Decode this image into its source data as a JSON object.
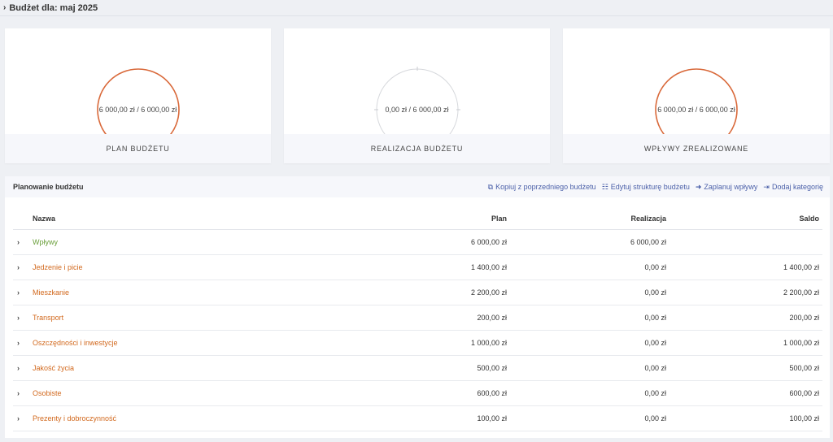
{
  "header": {
    "title": "Budżet dla: maj 2025",
    "toggle_icon": "chevron-right-icon"
  },
  "colors": {
    "accent_orange": "#d9693a",
    "income_green": "#6a9f3a",
    "link_blue": "#4a5fa8",
    "ring_empty": "#d6d8dc"
  },
  "cards": [
    {
      "value": "6 000,00 zł / 6 000,00 zł",
      "label": "PLAN BUDŻETU",
      "progress": 1.0
    },
    {
      "value": "0,00 zł / 6 000,00 zł",
      "label": "REALIZACJA BUDŻETU",
      "progress": 0.0
    },
    {
      "value": "6 000,00 zł / 6 000,00 zł",
      "label": "WPŁYWY ZREALIZOWANE",
      "progress": 1.0
    }
  ],
  "planning": {
    "title": "Planowanie budżetu",
    "actions": [
      {
        "label": "Kopiuj z poprzedniego budżetu",
        "icon": "copy-icon"
      },
      {
        "label": "Edytuj strukturę budżetu",
        "icon": "sitemap-icon"
      },
      {
        "label": "Zaplanuj wpływy",
        "icon": "sign-in-icon"
      },
      {
        "label": "Dodaj kategorię",
        "icon": "sign-out-icon"
      }
    ],
    "columns": {
      "name": "Nazwa",
      "plan": "Plan",
      "realized": "Realizacja",
      "balance": "Saldo"
    },
    "rows": [
      {
        "name": "Wpływy",
        "plan": "6 000,00 zł",
        "realized": "6 000,00 zł",
        "balance": "",
        "type": "income"
      },
      {
        "name": "Jedzenie i picie",
        "plan": "1 400,00 zł",
        "realized": "0,00 zł",
        "balance": "1 400,00 zł",
        "type": "expense"
      },
      {
        "name": "Mieszkanie",
        "plan": "2 200,00 zł",
        "realized": "0,00 zł",
        "balance": "2 200,00 zł",
        "type": "expense"
      },
      {
        "name": "Transport",
        "plan": "200,00 zł",
        "realized": "0,00 zł",
        "balance": "200,00 zł",
        "type": "expense"
      },
      {
        "name": "Oszczędności i inwestycje",
        "plan": "1 000,00 zł",
        "realized": "0,00 zł",
        "balance": "1 000,00 zł",
        "type": "expense"
      },
      {
        "name": "Jakość życia",
        "plan": "500,00 zł",
        "realized": "0,00 zł",
        "balance": "500,00 zł",
        "type": "expense"
      },
      {
        "name": "Osobiste",
        "plan": "600,00 zł",
        "realized": "0,00 zł",
        "balance": "600,00 zł",
        "type": "expense"
      },
      {
        "name": "Prezenty i dobroczynność",
        "plan": "100,00 zł",
        "realized": "0,00 zł",
        "balance": "100,00 zł",
        "type": "expense"
      }
    ]
  }
}
